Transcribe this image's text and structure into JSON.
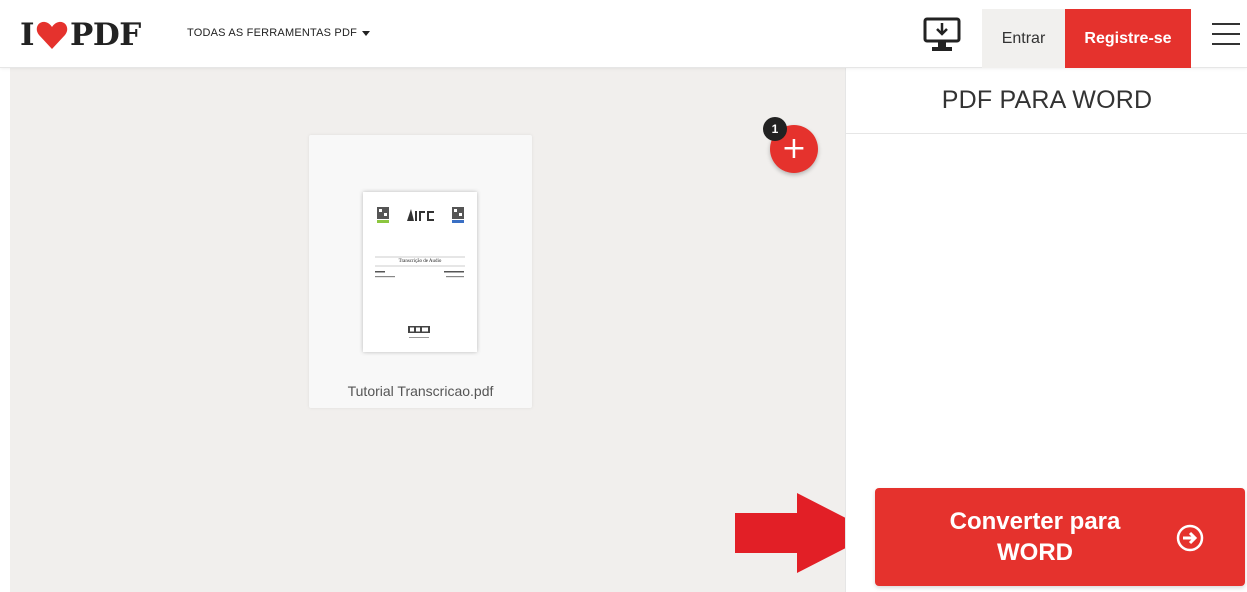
{
  "header": {
    "logo_left": "I",
    "logo_right": "PDF",
    "tools_menu_label": "TODAS AS FERRAMENTAS PDF",
    "login_label": "Entrar",
    "register_label": "Registre-se"
  },
  "workspace": {
    "file": {
      "name": "Tutorial Transcricao.pdf",
      "thumbnail_heading": "Transcrição de Audio"
    },
    "file_count": "1"
  },
  "sidebar": {
    "title": "PDF PARA WORD",
    "convert_button_label": "Converter para WORD"
  },
  "colors": {
    "brand_red": "#e5322d",
    "workspace_bg": "#f1efed",
    "arrow_red": "#e21f26"
  },
  "icons": {
    "heart": "heart-icon",
    "caret": "caret-down-icon",
    "desktop": "desktop-download-icon",
    "menu": "hamburger-menu-icon",
    "add": "plus-icon",
    "convert": "arrow-circle-right-icon"
  }
}
